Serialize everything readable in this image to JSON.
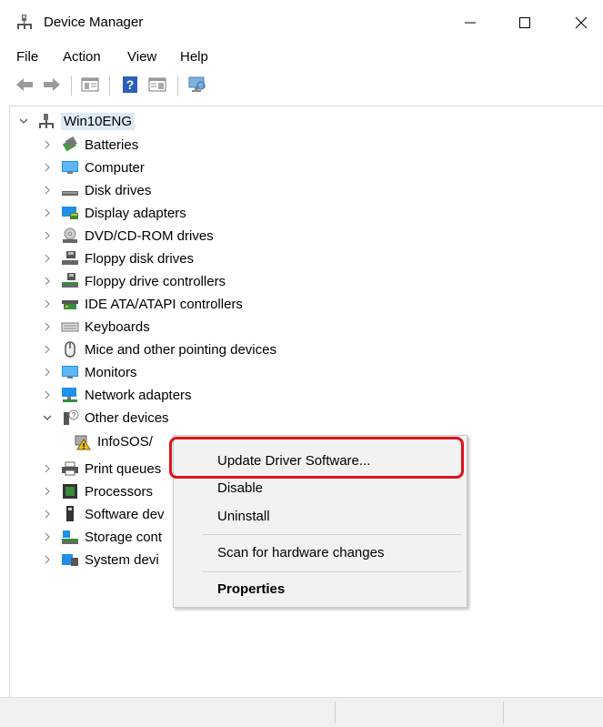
{
  "window": {
    "title": "Device Manager",
    "min_glyph": "—",
    "max_glyph": "☐",
    "close_glyph": "✕"
  },
  "menu": [
    "File",
    "Action",
    "View",
    "Help"
  ],
  "toolbar_icons": [
    "back-arrow-icon",
    "forward-arrow-icon",
    "show-hide-console-tree-icon",
    "help-icon",
    "properties-pane-icon",
    "monitor-scan-icon"
  ],
  "tree": {
    "root": "Win10ENG",
    "items": [
      {
        "label": "Batteries",
        "icon": "battery-icon"
      },
      {
        "label": "Computer",
        "icon": "computer-icon"
      },
      {
        "label": "Disk drives",
        "icon": "disk-drive-icon"
      },
      {
        "label": "Display adapters",
        "icon": "display-adapter-icon"
      },
      {
        "label": "DVD/CD-ROM drives",
        "icon": "dvd-icon"
      },
      {
        "label": "Floppy disk drives",
        "icon": "floppy-icon"
      },
      {
        "label": "Floppy drive controllers",
        "icon": "floppy-controller-icon"
      },
      {
        "label": "IDE ATA/ATAPI controllers",
        "icon": "ide-controller-icon"
      },
      {
        "label": "Keyboards",
        "icon": "keyboard-icon"
      },
      {
        "label": "Mice and other pointing devices",
        "icon": "mouse-icon"
      },
      {
        "label": "Monitors",
        "icon": "monitor-icon"
      },
      {
        "label": "Network adapters",
        "icon": "network-adapter-icon"
      },
      {
        "label": "Other devices",
        "icon": "other-devices-icon",
        "expanded": true
      },
      {
        "label": "InfoSOS/",
        "icon": "warning-device-icon",
        "child": true
      },
      {
        "label": "Print queues",
        "icon": "printer-icon"
      },
      {
        "label": "Processors",
        "icon": "processor-icon"
      },
      {
        "label": "Software dev",
        "icon": "software-device-icon"
      },
      {
        "label": "Storage cont",
        "icon": "storage-controller-icon"
      },
      {
        "label": "System devi",
        "icon": "system-devices-icon"
      }
    ]
  },
  "context_menu": {
    "update": "Update Driver Software...",
    "disable": "Disable",
    "uninstall": "Uninstall",
    "scan": "Scan for hardware changes",
    "properties": "Properties"
  },
  "colors": {
    "highlight_border": "#e0101a",
    "selection": "#dceaf7",
    "menu_bg": "#f2f2f2"
  }
}
